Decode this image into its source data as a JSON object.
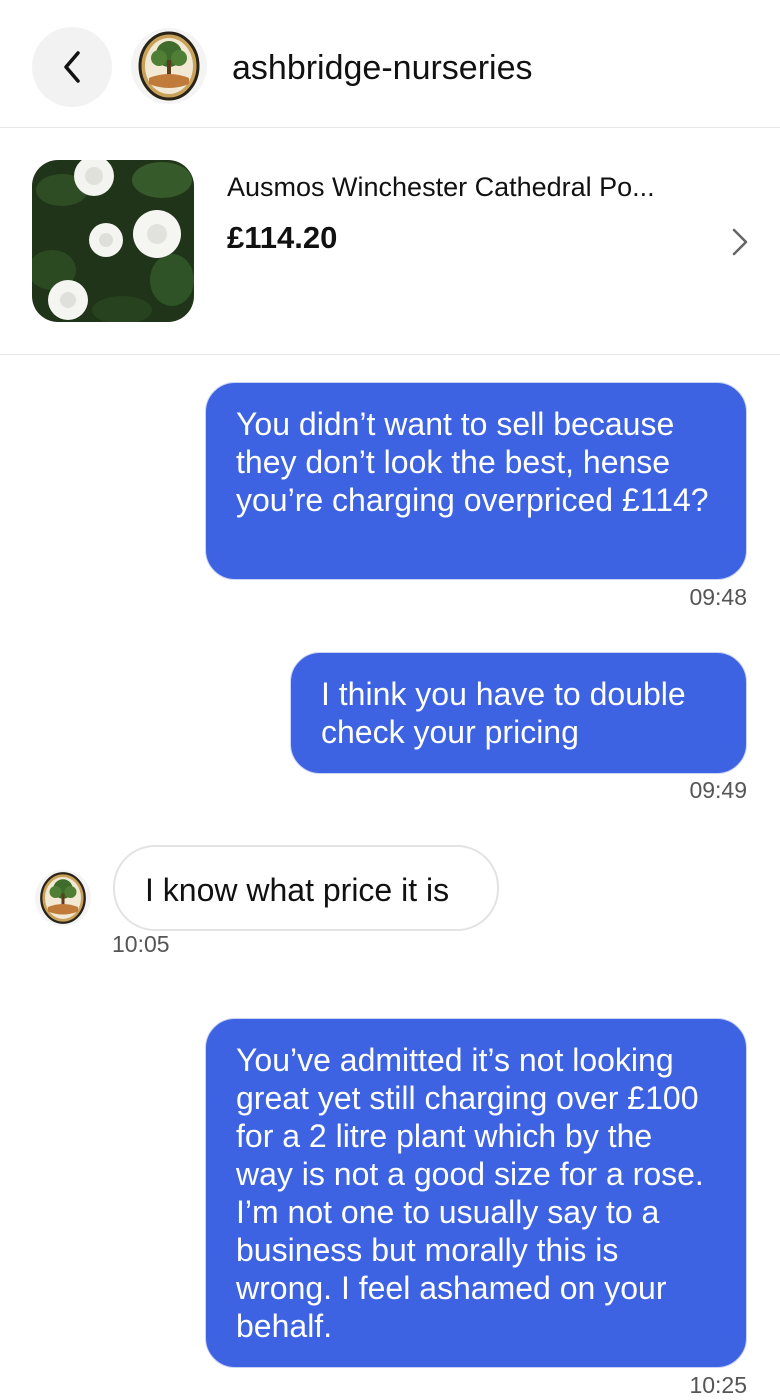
{
  "header": {
    "back_icon": "chevron-left-icon",
    "shop_name": "ashbridge-nurseries"
  },
  "product": {
    "title": "Ausmos Winchester Cathedral Po...",
    "price": "£114.20",
    "chevron_icon": "chevron-right-icon"
  },
  "messages": [
    {
      "direction": "out",
      "text": "You didn’t want to sell because they don’t look the best, hense you’re charging overpriced £114?",
      "time": "09:48"
    },
    {
      "direction": "out",
      "text": "I think you have to double check your pricing",
      "time": "09:49"
    },
    {
      "direction": "in",
      "text": "I know what price it is",
      "time": "10:05"
    },
    {
      "direction": "out",
      "text": "You’ve admitted it’s not looking great yet still charging over £100 for a 2 litre plant which by the way is not a good size for a rose. I’m not one to usually say to a business but morally this is wrong. I feel ashamed on your behalf.",
      "time": "10:25"
    }
  ],
  "colors": {
    "outgoing_bubble": "#3e63e2",
    "incoming_bubble_border": "#e3e3e3",
    "logo_gold": "#c9a25a"
  }
}
